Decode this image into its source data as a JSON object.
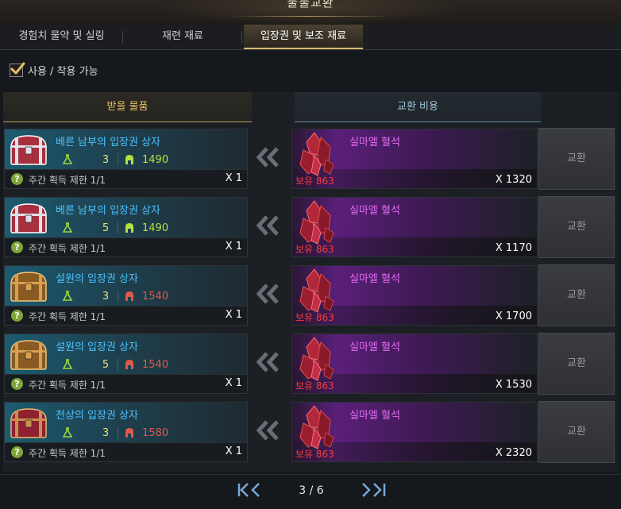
{
  "window": {
    "title": "물물교환"
  },
  "tabs": [
    {
      "label": "경험치 물약 및 실링",
      "active": false
    },
    {
      "label": "재련 재료",
      "active": false
    },
    {
      "label": "입장권 및 보조 재료",
      "active": true
    }
  ],
  "filter": {
    "label": "사용 / 착용 가능",
    "checked": true
  },
  "columns": {
    "receive": "받을 물품",
    "cost": "교환 비용"
  },
  "colors": {
    "accent_gold": "#e8c160",
    "item_name": "#4cc2ff",
    "cost_name": "#e26cf0",
    "owned_red": "#ff3a3a",
    "ilvl_ok": "#b4e040",
    "ilvl_bad": "#e05848"
  },
  "rows": [
    {
      "item": {
        "name": "베른 남부의 입장권 상자",
        "icon": "chest-red-icon",
        "qty_req": "3",
        "ilvl": "1490",
        "ilvl_status": "ok"
      },
      "limit": "주간 획득 제한 1/1",
      "receive_mult": "X 1",
      "cost": {
        "name": "실마엘 혈석",
        "icon": "bloodstone-icon",
        "owned": "보유 863",
        "mult": "X 1320"
      },
      "button": "교환"
    },
    {
      "item": {
        "name": "베른 남부의 입장권 상자",
        "icon": "chest-red-icon",
        "qty_req": "5",
        "ilvl": "1490",
        "ilvl_status": "ok"
      },
      "limit": "주간 획득 제한 1/1",
      "receive_mult": "X 1",
      "cost": {
        "name": "실마엘 혈석",
        "icon": "bloodstone-icon",
        "owned": "보유 863",
        "mult": "X 1170"
      },
      "button": "교환"
    },
    {
      "item": {
        "name": "설원의 입장권 상자",
        "icon": "chest-gold-icon",
        "qty_req": "3",
        "ilvl": "1540",
        "ilvl_status": "bad"
      },
      "limit": "주간 획득 제한 1/1",
      "receive_mult": "X 1",
      "cost": {
        "name": "실마엘 혈석",
        "icon": "bloodstone-icon",
        "owned": "보유 863",
        "mult": "X 1700"
      },
      "button": "교환"
    },
    {
      "item": {
        "name": "설원의 입장권 상자",
        "icon": "chest-gold-icon",
        "qty_req": "5",
        "ilvl": "1540",
        "ilvl_status": "bad"
      },
      "limit": "주간 획득 제한 1/1",
      "receive_mult": "X 1",
      "cost": {
        "name": "실마엘 혈석",
        "icon": "bloodstone-icon",
        "owned": "보유 863",
        "mult": "X 1530"
      },
      "button": "교환"
    },
    {
      "item": {
        "name": "천상의 입장권 상자",
        "icon": "chest-crimson-icon",
        "qty_req": "3",
        "ilvl": "1580",
        "ilvl_status": "bad"
      },
      "limit": "주간 획득 제한 1/1",
      "receive_mult": "X 1",
      "cost": {
        "name": "실마엘 혈석",
        "icon": "bloodstone-icon",
        "owned": "보유 863",
        "mult": "X 2320"
      },
      "button": "교환"
    }
  ],
  "pagination": {
    "current": "3 / 6"
  }
}
